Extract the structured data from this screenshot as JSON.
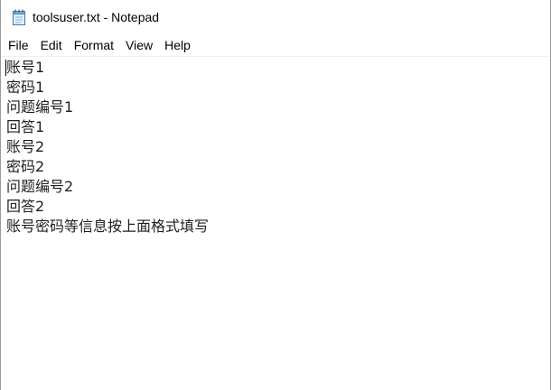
{
  "window": {
    "title": "toolsuser.txt - Notepad",
    "icon": "notepad-icon"
  },
  "menu": {
    "items": [
      "File",
      "Edit",
      "Format",
      "View",
      "Help"
    ]
  },
  "editor": {
    "lines": [
      "账号1",
      "密码1",
      "问题编号1",
      "回答1",
      "账号2",
      "密码2",
      "问题编号2",
      "回答2",
      "账号密码等信息按上面格式填写"
    ]
  }
}
